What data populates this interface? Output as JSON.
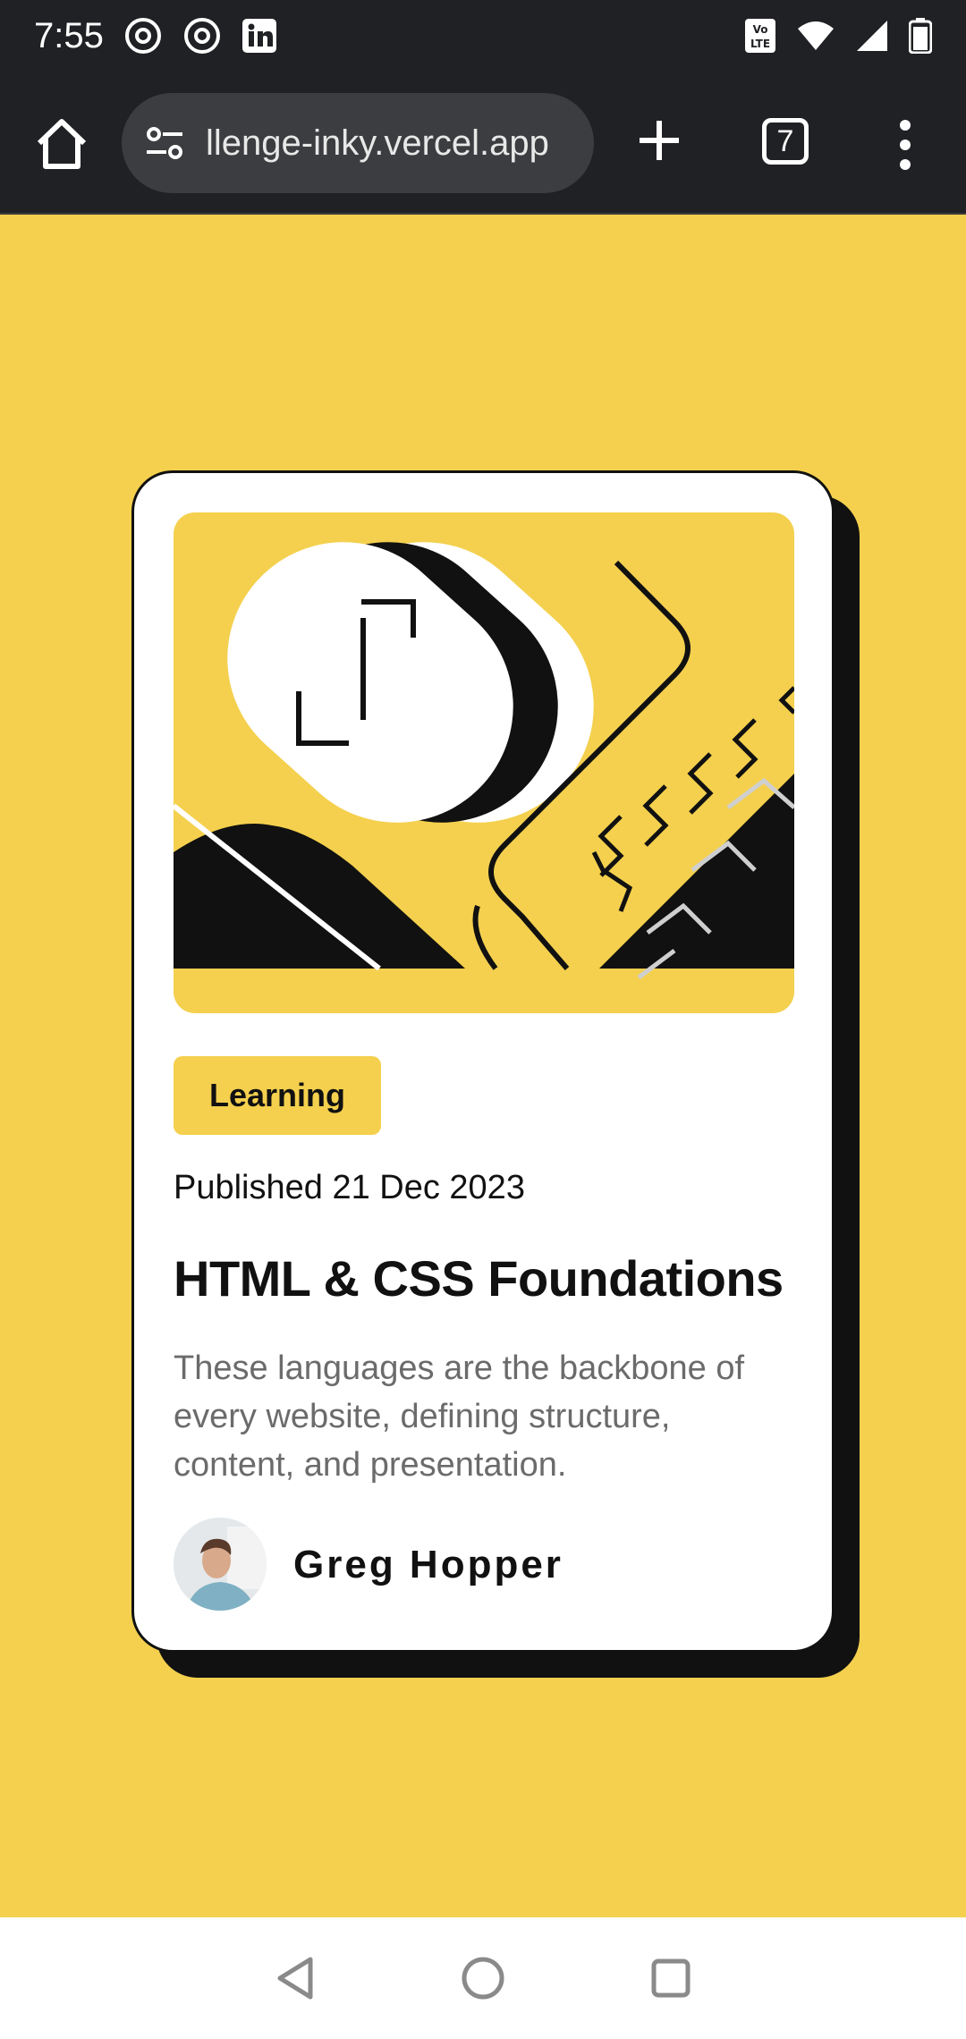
{
  "status_bar": {
    "time": "7:55",
    "left_icons": [
      "threads-icon",
      "threads-icon",
      "linkedin-icon"
    ],
    "right_icons": [
      "volte-icon",
      "wifi-icon",
      "signal-icon",
      "battery-icon"
    ]
  },
  "browser": {
    "url": "llenge-inky.vercel.app",
    "tab_count": "7"
  },
  "card": {
    "tag": "Learning",
    "published": "Published 21 Dec 2023",
    "title": "HTML & CSS Foundations",
    "description": "These languages are the backbone of every website, defining structure, content, and presentation.",
    "author": "Greg Hopper"
  },
  "colors": {
    "background": "#f4d04e",
    "card": "#ffffff",
    "text": "#111111",
    "muted_text": "#6b6b6b",
    "chrome": "#202124"
  }
}
